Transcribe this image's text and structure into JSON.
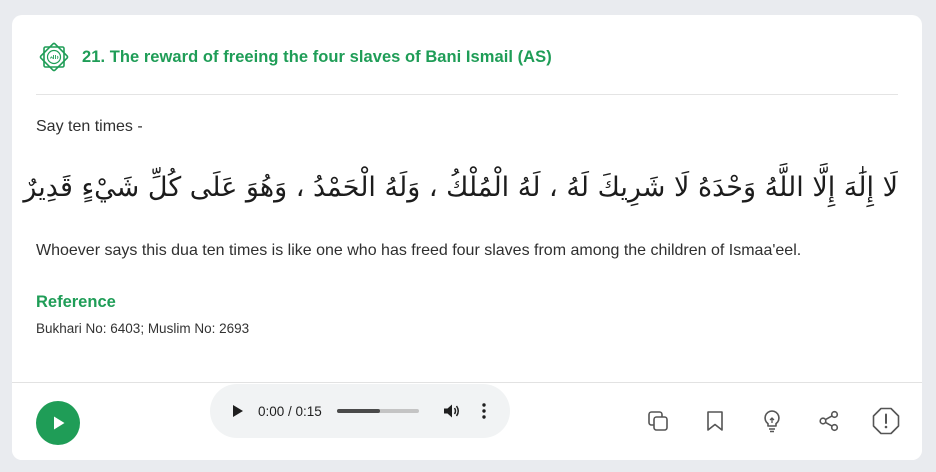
{
  "card": {
    "number_title": "21. The reward of freeing the four slaves of Bani Ismail (AS)",
    "emblem_icon": "allah-emblem-icon",
    "instruction": "Say ten times -",
    "arabic": "لَا إِلَٰهَ إِلَّا اللَّهُ وَحْدَهُ لَا شَرِيكَ لَهُ ، لَهُ الْمُلْكُ ، وَلَهُ الْحَمْدُ ، وَهُوَ عَلَى كُلِّ شَيْءٍ قَدِيرٌ",
    "translation": "Whoever says this dua ten times is like one who has freed four slaves from among the children of Ismaa'eel.",
    "reference_heading": "Reference",
    "reference_text": "Bukhari No: 6403; Muslim No: 2693"
  },
  "footer": {
    "play_icon": "play-icon",
    "audio": {
      "time": "0:00 / 0:15",
      "progress": 0.53
    },
    "actions": [
      {
        "name": "copy-icon"
      },
      {
        "name": "bookmark-icon"
      },
      {
        "name": "lightbulb-icon"
      },
      {
        "name": "share-icon"
      },
      {
        "name": "report-icon"
      }
    ]
  },
  "colors": {
    "accent": "#1f9d57",
    "page_bg": "#e9ebef",
    "card_bg": "#ffffff"
  }
}
